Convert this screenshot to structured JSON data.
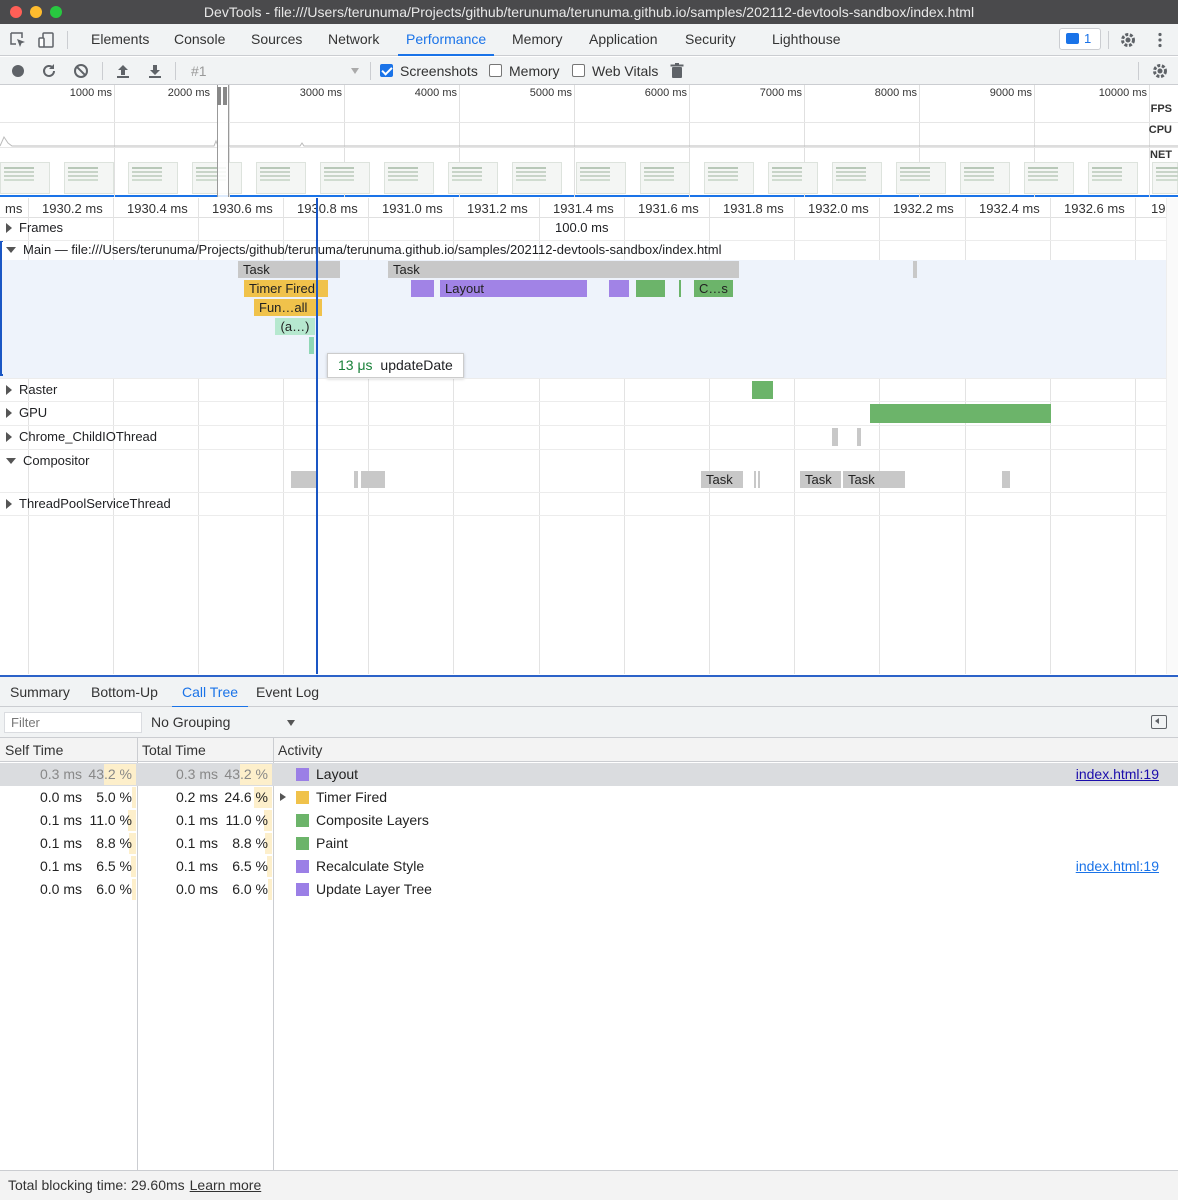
{
  "window": {
    "title": "DevTools - file:///Users/terunuma/Projects/github/terunuma/terunuma.github.io/samples/202112-devtools-sandbox/index.html"
  },
  "tabs": [
    {
      "label": "Elements"
    },
    {
      "label": "Console"
    },
    {
      "label": "Sources"
    },
    {
      "label": "Network"
    },
    {
      "label": "Performance"
    },
    {
      "label": "Memory"
    },
    {
      "label": "Application"
    },
    {
      "label": "Security"
    },
    {
      "label": "Lighthouse"
    }
  ],
  "issues": {
    "count": "1"
  },
  "perf_toolbar": {
    "profile_select": "#1",
    "screenshots_label": "Screenshots",
    "screenshots_checked": true,
    "memory_label": "Memory",
    "memory_checked": false,
    "webvitals_label": "Web Vitals",
    "webvitals_checked": false
  },
  "overview": {
    "ticks": [
      "1000 ms",
      "2000 ms",
      "3000 ms",
      "4000 ms",
      "5000 ms",
      "6000 ms",
      "7000 ms",
      "8000 ms",
      "9000 ms",
      "10000 ms"
    ],
    "fps": "FPS",
    "cpu": "CPU",
    "net": "NET"
  },
  "ruler": {
    "labels": [
      "ms",
      "1930.2 ms",
      "1930.4 ms",
      "1930.6 ms",
      "1930.8 ms",
      "1931.0 ms",
      "1931.2 ms",
      "1931.4 ms",
      "1931.6 ms",
      "1931.8 ms",
      "1932.0 ms",
      "1932.2 ms",
      "1932.4 ms",
      "1932.6 ms",
      "19"
    ],
    "frame_duration": "100.0 ms"
  },
  "tracks": {
    "frames": "Frames",
    "main": "Main — file:///Users/terunuma/Projects/github/terunuma/terunuma.github.io/samples/202112-devtools-sandbox/index.html",
    "raster": "Raster",
    "gpu": "GPU",
    "childio": "Chrome_ChildIOThread",
    "compositor": "Compositor",
    "threadpool": "ThreadPoolServiceThread"
  },
  "flame": {
    "task1": "Task",
    "task2": "Task",
    "timer_fired": "Timer Fired",
    "function_call": "Fun…all",
    "anonymous": "(a…)",
    "layout": "Layout",
    "composite": "C…s",
    "comp_task1": "Task",
    "comp_task2": "Task",
    "comp_task3": "Task"
  },
  "tooltip": {
    "duration": "13 μs",
    "name": "updateDate"
  },
  "bottom_tabs": [
    {
      "label": "Summary"
    },
    {
      "label": "Bottom-Up"
    },
    {
      "label": "Call Tree"
    },
    {
      "label": "Event Log"
    }
  ],
  "filter": {
    "placeholder": "Filter",
    "grouping": "No Grouping"
  },
  "columns": {
    "self": "Self Time",
    "total": "Total Time",
    "activity": "Activity"
  },
  "rows": [
    {
      "self_ms": "0.3 ms",
      "self_pct": "43.2 %",
      "self_frac": 0.432,
      "total_ms": "0.3 ms",
      "total_pct": "43.2 %",
      "total_frac": 0.432,
      "name": "Layout",
      "color": "#9b7fe6",
      "link": "index.html:19"
    },
    {
      "self_ms": "0.0 ms",
      "self_pct": "5.0 %",
      "self_frac": 0.05,
      "total_ms": "0.2 ms",
      "total_pct": "24.6 %",
      "total_frac": 0.246,
      "name": "Timer Fired",
      "color": "#f0c24b",
      "link": ""
    },
    {
      "self_ms": "0.1 ms",
      "self_pct": "11.0 %",
      "self_frac": 0.11,
      "total_ms": "0.1 ms",
      "total_pct": "11.0 %",
      "total_frac": 0.11,
      "name": "Composite Layers",
      "color": "#6cb46a",
      "link": ""
    },
    {
      "self_ms": "0.1 ms",
      "self_pct": "8.8 %",
      "self_frac": 0.088,
      "total_ms": "0.1 ms",
      "total_pct": "8.8 %",
      "total_frac": 0.088,
      "name": "Paint",
      "color": "#6cb46a",
      "link": ""
    },
    {
      "self_ms": "0.1 ms",
      "self_pct": "6.5 %",
      "self_frac": 0.065,
      "total_ms": "0.1 ms",
      "total_pct": "6.5 %",
      "total_frac": 0.065,
      "name": "Recalculate Style",
      "color": "#9b7fe6",
      "link": "index.html:19"
    },
    {
      "self_ms": "0.0 ms",
      "self_pct": "6.0 %",
      "self_frac": 0.06,
      "total_ms": "0.0 ms",
      "total_pct": "6.0 %",
      "total_frac": 0.06,
      "name": "Update Layer Tree",
      "color": "#9b7fe6",
      "link": ""
    }
  ],
  "footer": {
    "text": "Total blocking time: 29.60ms",
    "link": "Learn more"
  }
}
